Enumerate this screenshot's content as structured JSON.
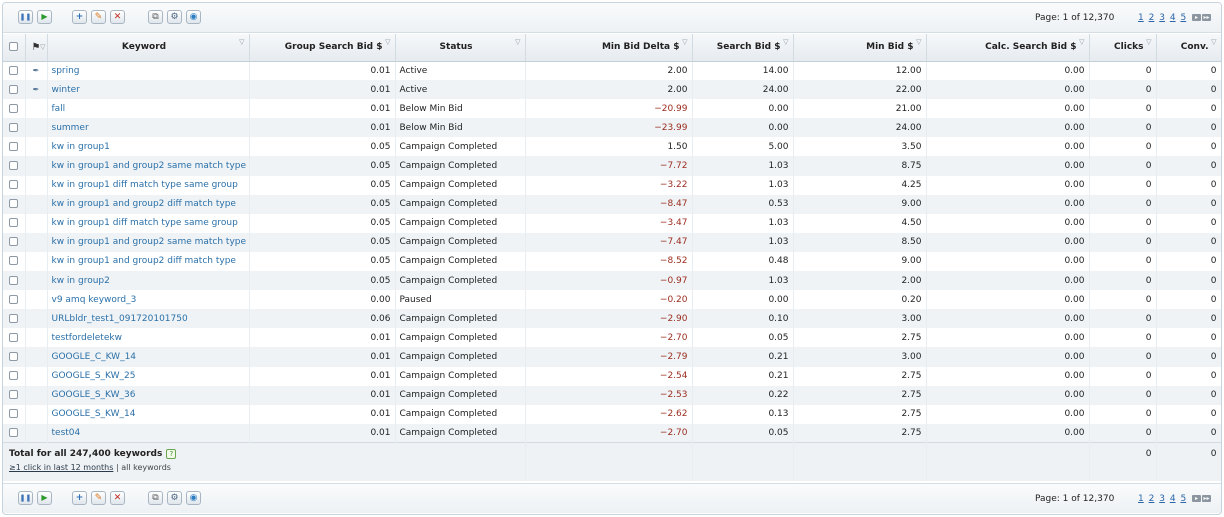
{
  "toolbar": {
    "page_label": "Page: 1 of 12,370",
    "pages": [
      "1",
      "2",
      "3",
      "4",
      "5"
    ],
    "icons": [
      "pause-icon",
      "play-icon",
      "add-icon",
      "edit-icon",
      "delete-icon",
      "copy-icon",
      "settings-icon",
      "globe-icon"
    ]
  },
  "columns": {
    "keyword": "Keyword",
    "group_bid": "Group Search Bid $",
    "status": "Status",
    "min_delta": "Min Bid Delta $",
    "search_bid": "Search Bid $",
    "min_bid": "Min Bid $",
    "calc_bid": "Calc. Search Bid $",
    "clicks": "Clicks",
    "conv": "Conv."
  },
  "rows": [
    {
      "kw": "spring",
      "group_bid": "0.01",
      "status": "Active",
      "delta": "2.00",
      "search_bid": "14.00",
      "min_bid": "12.00",
      "calc": "0.00",
      "clicks": "0",
      "conv": "0",
      "neg": false,
      "pin": true
    },
    {
      "kw": "winter",
      "group_bid": "0.01",
      "status": "Active",
      "delta": "2.00",
      "search_bid": "24.00",
      "min_bid": "22.00",
      "calc": "0.00",
      "clicks": "0",
      "conv": "0",
      "neg": false,
      "pin": true
    },
    {
      "kw": "fall",
      "group_bid": "0.01",
      "status": "Below Min Bid",
      "delta": "−20.99",
      "search_bid": "0.00",
      "min_bid": "21.00",
      "calc": "0.00",
      "clicks": "0",
      "conv": "0",
      "neg": true,
      "pin": false
    },
    {
      "kw": "summer",
      "group_bid": "0.01",
      "status": "Below Min Bid",
      "delta": "−23.99",
      "search_bid": "0.00",
      "min_bid": "24.00",
      "calc": "0.00",
      "clicks": "0",
      "conv": "0",
      "neg": true,
      "pin": false
    },
    {
      "kw": "kw in group1",
      "group_bid": "0.05",
      "status": "Campaign Completed",
      "delta": "1.50",
      "search_bid": "5.00",
      "min_bid": "3.50",
      "calc": "0.00",
      "clicks": "0",
      "conv": "0",
      "neg": false,
      "pin": false
    },
    {
      "kw": "kw in group1 and group2 same match type",
      "group_bid": "0.05",
      "status": "Campaign Completed",
      "delta": "−7.72",
      "search_bid": "1.03",
      "min_bid": "8.75",
      "calc": "0.00",
      "clicks": "0",
      "conv": "0",
      "neg": true,
      "pin": false
    },
    {
      "kw": "kw in group1 diff match type same group",
      "group_bid": "0.05",
      "status": "Campaign Completed",
      "delta": "−3.22",
      "search_bid": "1.03",
      "min_bid": "4.25",
      "calc": "0.00",
      "clicks": "0",
      "conv": "0",
      "neg": true,
      "pin": false
    },
    {
      "kw": "kw in group1 and group2 diff match type",
      "group_bid": "0.05",
      "status": "Campaign Completed",
      "delta": "−8.47",
      "search_bid": "0.53",
      "min_bid": "9.00",
      "calc": "0.00",
      "clicks": "0",
      "conv": "0",
      "neg": true,
      "pin": false
    },
    {
      "kw": "kw in group1 diff match type same group",
      "group_bid": "0.05",
      "status": "Campaign Completed",
      "delta": "−3.47",
      "search_bid": "1.03",
      "min_bid": "4.50",
      "calc": "0.00",
      "clicks": "0",
      "conv": "0",
      "neg": true,
      "pin": false
    },
    {
      "kw": "kw in group1 and group2 same match type",
      "group_bid": "0.05",
      "status": "Campaign Completed",
      "delta": "−7.47",
      "search_bid": "1.03",
      "min_bid": "8.50",
      "calc": "0.00",
      "clicks": "0",
      "conv": "0",
      "neg": true,
      "pin": false
    },
    {
      "kw": "kw in group1 and group2 diff match type",
      "group_bid": "0.05",
      "status": "Campaign Completed",
      "delta": "−8.52",
      "search_bid": "0.48",
      "min_bid": "9.00",
      "calc": "0.00",
      "clicks": "0",
      "conv": "0",
      "neg": true,
      "pin": false
    },
    {
      "kw": "kw in group2",
      "group_bid": "0.05",
      "status": "Campaign Completed",
      "delta": "−0.97",
      "search_bid": "1.03",
      "min_bid": "2.00",
      "calc": "0.00",
      "clicks": "0",
      "conv": "0",
      "neg": true,
      "pin": false
    },
    {
      "kw": "v9 amq keyword_3",
      "group_bid": "0.00",
      "status": "Paused",
      "delta": "−0.20",
      "search_bid": "0.00",
      "min_bid": "0.20",
      "calc": "0.00",
      "clicks": "0",
      "conv": "0",
      "neg": true,
      "pin": false
    },
    {
      "kw": "URLbldr_test1_091720101750",
      "group_bid": "0.06",
      "status": "Campaign Completed",
      "delta": "−2.90",
      "search_bid": "0.10",
      "min_bid": "3.00",
      "calc": "0.00",
      "clicks": "0",
      "conv": "0",
      "neg": true,
      "pin": false
    },
    {
      "kw": "testfordeletekw",
      "group_bid": "0.01",
      "status": "Campaign Completed",
      "delta": "−2.70",
      "search_bid": "0.05",
      "min_bid": "2.75",
      "calc": "0.00",
      "clicks": "0",
      "conv": "0",
      "neg": true,
      "pin": false
    },
    {
      "kw": "GOOGLE_C_KW_14",
      "group_bid": "0.01",
      "status": "Campaign Completed",
      "delta": "−2.79",
      "search_bid": "0.21",
      "min_bid": "3.00",
      "calc": "0.00",
      "clicks": "0",
      "conv": "0",
      "neg": true,
      "pin": false
    },
    {
      "kw": "GOOGLE_S_KW_25",
      "group_bid": "0.01",
      "status": "Campaign Completed",
      "delta": "−2.54",
      "search_bid": "0.21",
      "min_bid": "2.75",
      "calc": "0.00",
      "clicks": "0",
      "conv": "0",
      "neg": true,
      "pin": false
    },
    {
      "kw": "GOOGLE_S_KW_36",
      "group_bid": "0.01",
      "status": "Campaign Completed",
      "delta": "−2.53",
      "search_bid": "0.22",
      "min_bid": "2.75",
      "calc": "0.00",
      "clicks": "0",
      "conv": "0",
      "neg": true,
      "pin": false
    },
    {
      "kw": "GOOGLE_S_KW_14",
      "group_bid": "0.01",
      "status": "Campaign Completed",
      "delta": "−2.62",
      "search_bid": "0.13",
      "min_bid": "2.75",
      "calc": "0.00",
      "clicks": "0",
      "conv": "0",
      "neg": true,
      "pin": false
    },
    {
      "kw": "test04",
      "group_bid": "0.01",
      "status": "Campaign Completed",
      "delta": "−2.70",
      "search_bid": "0.05",
      "min_bid": "2.75",
      "calc": "0.00",
      "clicks": "0",
      "conv": "0",
      "neg": true,
      "pin": false
    }
  ],
  "total": {
    "label": "Total for all 247,400 keywords",
    "help": "?",
    "filter_link": "≥1 click in last 12 months",
    "separator": "|",
    "all_label": "all keywords",
    "clicks": "0",
    "conv": "0"
  },
  "colors": {
    "link": "#2b70a8",
    "negative": "#9b2d1f",
    "row_alt": "#eff3f6",
    "header_bg": "#e6ebef"
  }
}
